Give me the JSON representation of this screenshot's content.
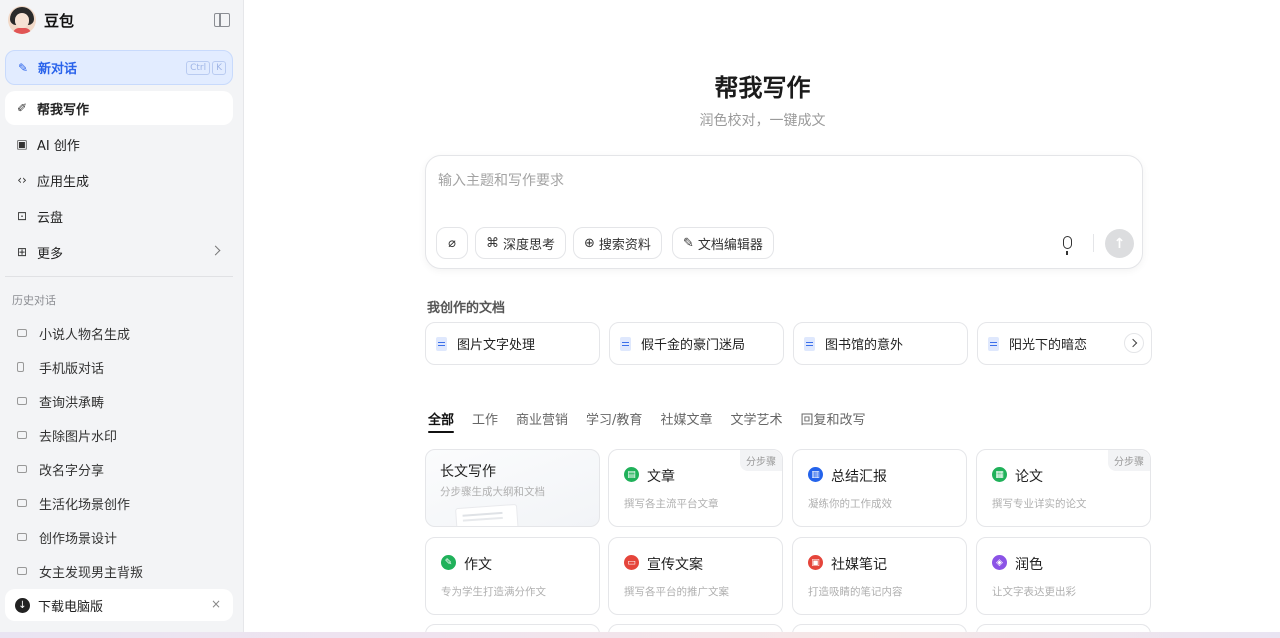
{
  "app": {
    "name": "豆包"
  },
  "sidebar": {
    "new_chat": {
      "label": "新对话",
      "shortcut": [
        "Ctrl",
        "K"
      ]
    },
    "items": [
      {
        "label": "帮我写作",
        "icon": "pen-sparkle-icon",
        "active": true
      },
      {
        "label": "AI 创作",
        "icon": "image-sparkle-icon"
      },
      {
        "label": "应用生成",
        "icon": "code-icon"
      },
      {
        "label": "云盘",
        "icon": "cloud-drive-icon"
      },
      {
        "label": "更多",
        "icon": "grid-icon"
      }
    ],
    "history_title": "历史对话",
    "history": [
      {
        "label": "小说人物名生成",
        "icon": "chat-icon"
      },
      {
        "label": "手机版对话",
        "icon": "phone-icon"
      },
      {
        "label": "查询洪承畴",
        "icon": "chat-icon"
      },
      {
        "label": "去除图片水印",
        "icon": "chat-icon"
      },
      {
        "label": "改名字分享",
        "icon": "chat-icon"
      },
      {
        "label": "生活化场景创作",
        "icon": "chat-icon"
      },
      {
        "label": "创作场景设计",
        "icon": "chat-icon"
      },
      {
        "label": "女主发现男主背叛",
        "icon": "chat-icon"
      }
    ],
    "download": {
      "label": "下载电脑版",
      "close": "×"
    }
  },
  "main": {
    "title": "帮我写作",
    "subtitle": "润色校对，一键成文",
    "composer": {
      "placeholder": "输入主题和写作要求",
      "tools": [
        "深度思考",
        "搜索资料",
        "文档编辑器"
      ],
      "send_glyph": "↑"
    },
    "docs_title": "我创作的文档",
    "docs": [
      "图片文字处理",
      "假千金的豪门迷局",
      "图书馆的意外",
      "阳光下的暗恋"
    ],
    "tabs": [
      "全部",
      "工作",
      "商业营销",
      "学习/教育",
      "社媒文章",
      "文学艺术",
      "回复和改写"
    ],
    "cards": [
      {
        "title": "长文写作",
        "desc": "分步骤生成大纲和文档",
        "badge": ""
      },
      {
        "title": "文章",
        "desc": "撰写各主流平台文章",
        "badge": "分步骤",
        "color": "#20b15a"
      },
      {
        "title": "总结汇报",
        "desc": "凝练你的工作成效",
        "badge": "",
        "color": "#2463eb"
      },
      {
        "title": "论文",
        "desc": "撰写专业详实的论文",
        "badge": "分步骤",
        "color": "#20b15a"
      },
      {
        "title": "作文",
        "desc": "专为学生打造满分作文",
        "badge": "",
        "color": "#20b15a"
      },
      {
        "title": "宣传文案",
        "desc": "撰写各平台的推广文案",
        "badge": "",
        "color": "#e5453b"
      },
      {
        "title": "社媒笔记",
        "desc": "打造吸睛的笔记内容",
        "badge": "",
        "color": "#e5453b"
      },
      {
        "title": "润色",
        "desc": "让文字表达更出彩",
        "badge": "",
        "color": "#8b53e6"
      }
    ]
  }
}
